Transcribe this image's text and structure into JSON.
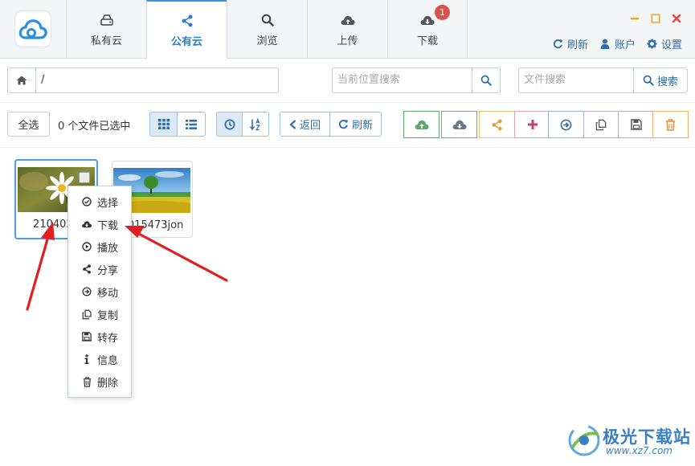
{
  "tabs": [
    {
      "label": "私有云",
      "icon": "hdd-icon"
    },
    {
      "label": "公有云",
      "icon": "share-icon"
    },
    {
      "label": "浏览",
      "icon": "search-icon"
    },
    {
      "label": "上传",
      "icon": "cloud-upload-icon"
    },
    {
      "label": "下载",
      "icon": "cloud-download-icon",
      "badge": "1"
    }
  ],
  "active_tab": "公有云",
  "top_actions": {
    "refresh": "刷新",
    "account": "账户",
    "settings": "设置"
  },
  "path": {
    "value": "/"
  },
  "search": {
    "location_placeholder": "当前位置搜索",
    "file_placeholder": "文件搜索",
    "file_button": "搜索"
  },
  "toolbar": {
    "select_all": "全选",
    "selection_status": "0 个文件已选中",
    "back": "返回",
    "refresh": "刷新"
  },
  "action_buttons": [
    {
      "name": "upload",
      "icon": "cloud-upload-icon",
      "color": "#5aa86a"
    },
    {
      "name": "download",
      "icon": "cloud-download-icon",
      "color": "#6b7785"
    },
    {
      "name": "share",
      "icon": "share-icon",
      "color": "#e0a43a"
    },
    {
      "name": "new",
      "icon": "plus-icon",
      "color": "#c0446e"
    },
    {
      "name": "move",
      "icon": "arrow-circle-icon",
      "color": "#3f6f9e"
    },
    {
      "name": "copy",
      "icon": "copy-icon",
      "color": "#7a6aa8"
    },
    {
      "name": "save",
      "icon": "save-icon",
      "color": "#555555"
    },
    {
      "name": "delete",
      "icon": "trash-icon",
      "color": "#e08a3a"
    }
  ],
  "files": [
    {
      "name": "2104021",
      "thumb": "daisy"
    },
    {
      "name": "2015473jon",
      "thumb": "field"
    }
  ],
  "context_menu": [
    {
      "label": "选择",
      "icon": "check-circle-icon"
    },
    {
      "label": "下载",
      "icon": "cloud-download-icon"
    },
    {
      "label": "播放",
      "icon": "play-circle-icon"
    },
    {
      "label": "分享",
      "icon": "share-icon"
    },
    {
      "label": "移动",
      "icon": "arrow-circle-icon"
    },
    {
      "label": "复制",
      "icon": "copy-icon"
    },
    {
      "label": "转存",
      "icon": "save-icon"
    },
    {
      "label": "信息",
      "icon": "info-icon"
    },
    {
      "label": "删除",
      "icon": "trash-icon"
    }
  ],
  "watermark": {
    "title": "极光下载站",
    "url": "www.xz7.com"
  },
  "colors": {
    "accent": "#3a96dd",
    "link": "#2f6ea6",
    "arrow": "#e02020",
    "badge": "#d9534f"
  }
}
